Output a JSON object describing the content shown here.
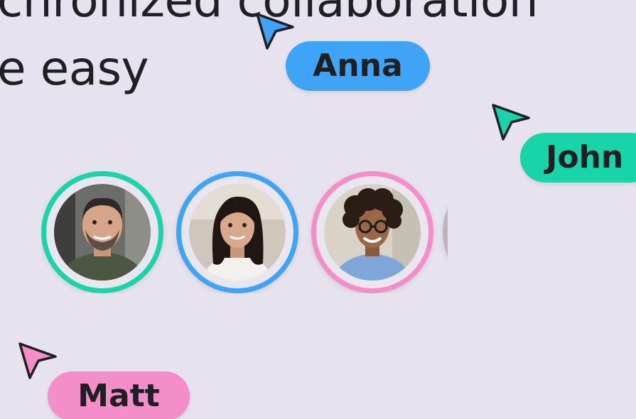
{
  "headline": {
    "line1": "chronized collaboration",
    "line2": "e easy"
  },
  "collaborators": [
    {
      "name": "Anna",
      "color": "#3fa3f6",
      "cursor_icon": "arrow-cursor-icon"
    },
    {
      "name": "John",
      "color": "#19d4a8",
      "cursor_icon": "arrow-cursor-icon"
    },
    {
      "name": "Matt",
      "color": "#f48ec8",
      "cursor_icon": "arrow-cursor-icon"
    }
  ],
  "avatars": [
    {
      "ring_color": "#19d4a8",
      "photo": "man-with-beard-portrait"
    },
    {
      "ring_color": "#3fa3f6",
      "photo": "woman-with-dark-hair-portrait"
    },
    {
      "ring_color": "#f48ec8",
      "photo": "man-with-curly-hair-and-glasses-portrait"
    },
    {
      "ring_color": "#b8b4c2",
      "photo": "partially-hidden-avatar"
    }
  ],
  "colors": {
    "background": "#e6e2ee",
    "text": "#1f1f24"
  }
}
